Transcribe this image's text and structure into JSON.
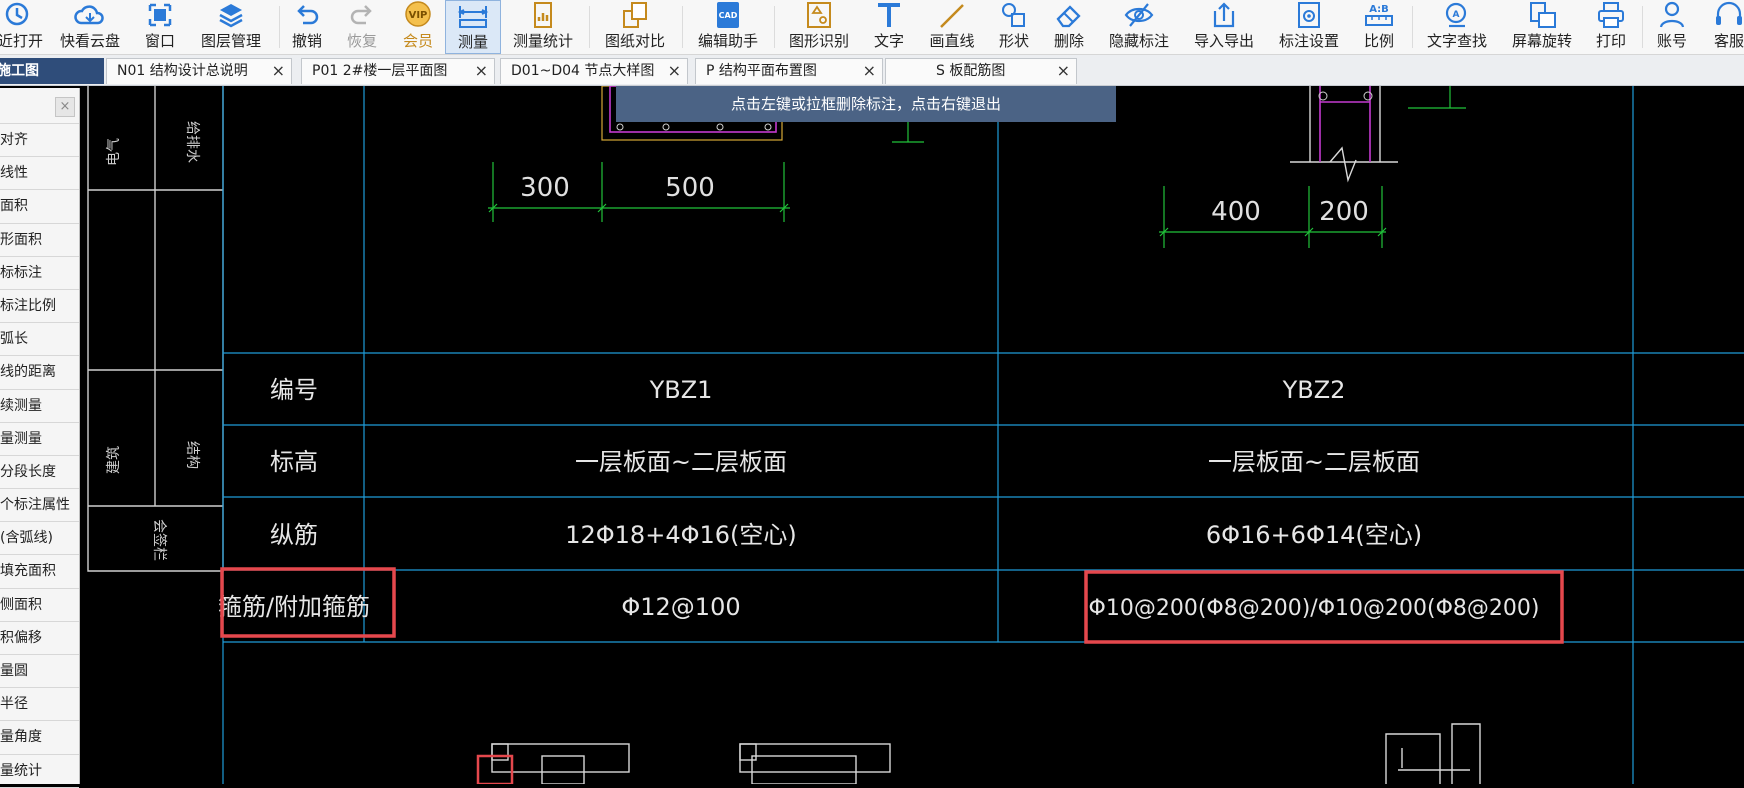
{
  "toolbar": {
    "items": [
      {
        "label": "最近打开",
        "icon": "history-icon"
      },
      {
        "label": "快看云盘",
        "icon": "cloud-icon"
      },
      {
        "label": "窗口",
        "icon": "window-icon"
      },
      {
        "label": "图层管理",
        "icon": "layers-icon"
      },
      {
        "label": "撤销",
        "icon": "undo-icon"
      },
      {
        "label": "恢复",
        "icon": "redo-icon"
      },
      {
        "label": "会员",
        "icon": "vip-icon",
        "badge": "VIP"
      },
      {
        "label": "测量",
        "icon": "measure-icon"
      },
      {
        "label": "测量统计",
        "icon": "measure-stats-icon"
      },
      {
        "label": "图纸对比",
        "icon": "compare-icon"
      },
      {
        "label": "编辑助手",
        "icon": "cad-edit-icon",
        "badge": "CAD"
      },
      {
        "label": "图形识别",
        "icon": "shape-recognize-icon"
      },
      {
        "label": "文字",
        "icon": "text-icon"
      },
      {
        "label": "画直线",
        "icon": "line-icon"
      },
      {
        "label": "形状",
        "icon": "shape-icon"
      },
      {
        "label": "删除",
        "icon": "eraser-icon"
      },
      {
        "label": "隐藏标注",
        "icon": "eye-off-icon"
      },
      {
        "label": "导入导出",
        "icon": "import-export-icon"
      },
      {
        "label": "标注设置",
        "icon": "annotation-settings-icon"
      },
      {
        "label": "比例",
        "icon": "scale-icon",
        "badge": "A:B"
      },
      {
        "label": "文字查找",
        "icon": "text-search-icon"
      },
      {
        "label": "屏幕旋转",
        "icon": "screen-rotate-icon"
      },
      {
        "label": "打印",
        "icon": "printer-icon"
      },
      {
        "label": "账号",
        "icon": "user-icon"
      },
      {
        "label": "客服",
        "icon": "headset-icon"
      }
    ]
  },
  "tabs": [
    {
      "label": "施工图",
      "active": true
    },
    {
      "label": "N01 结构设计总说明"
    },
    {
      "label": "P01 2#楼一层平面图"
    },
    {
      "label": "D01~D04 节点大样图"
    },
    {
      "label": "P 结构平面布置图"
    },
    {
      "label": "S 板配筋图"
    }
  ],
  "tab_close": "×",
  "tip": "点击左键或拉框删除标注，点击右键退出",
  "left_panel": {
    "close": "×",
    "items": [
      "对齐",
      "线性",
      "面积",
      "形面积",
      "标标注",
      "标注比例",
      "弧长",
      "线的距离",
      "续测量",
      "量测量",
      "分段长度",
      "个标注属性",
      "(含弧线)",
      "填充面积",
      "侧面积",
      "积偏移",
      "量圆",
      "半径",
      "量角度",
      "量统计"
    ]
  },
  "drawing": {
    "stamp_labels": [
      "电气",
      "给排水",
      "建筑",
      "结构",
      "会签栏"
    ],
    "dims_left": [
      "300",
      "500"
    ],
    "dims_right": [
      "400",
      "200"
    ],
    "row_headers": [
      "编号",
      "标高",
      "纵筋",
      "箍筋/附加箍筋"
    ],
    "columns": [
      {
        "id": "YBZ1",
        "elevation": "一层板面~二层板面",
        "long_bars": "12Φ18+4Φ16(空心)",
        "stirrups": "Φ12@100"
      },
      {
        "id": "YBZ2",
        "elevation": "一层板面~二层板面",
        "long_bars": "6Φ16+6Φ14(空心)",
        "stirrups": "Φ10@200(Φ8@200)/Φ10@200(Φ8@200)"
      }
    ]
  },
  "colors": {
    "grid": "#1f9bd8",
    "dim": "#21c23a",
    "highlight": "#e5484d",
    "tip_bg": "#4b6385",
    "active_tab": "#2f4d7a"
  }
}
